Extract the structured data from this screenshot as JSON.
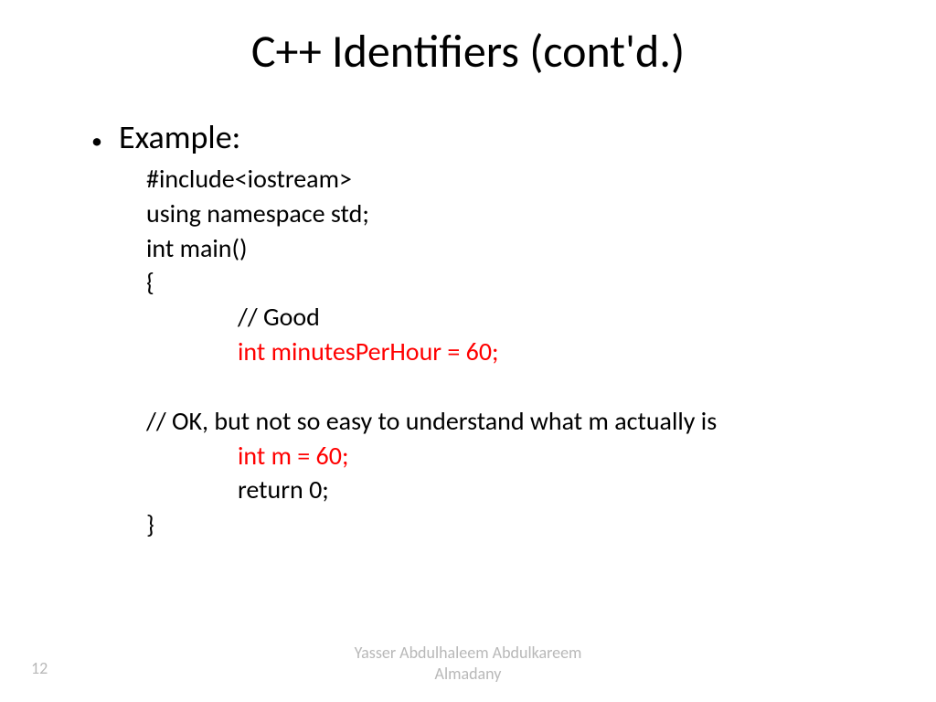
{
  "slide": {
    "title": "C++ Identifiers (cont'd.)",
    "bullet_label": "Example:",
    "code": {
      "line1": "#include<iostream>",
      "line2": "using namespace std;",
      "line3": "int main()",
      "line4": "{",
      "line5": "// Good",
      "line6": "int minutesPerHour = 60;",
      "line7": "// OK, but not so easy to understand what m actually is",
      "line8": "int m = 60;",
      "line9": "return 0;",
      "line10": "}"
    },
    "footer": {
      "author_line1": "Yasser Abdulhaleem Abdulkareem",
      "author_line2": "Almadany",
      "page_number": "12"
    }
  },
  "colors": {
    "highlight": "#ff0000",
    "muted": "#b8b8b8"
  }
}
